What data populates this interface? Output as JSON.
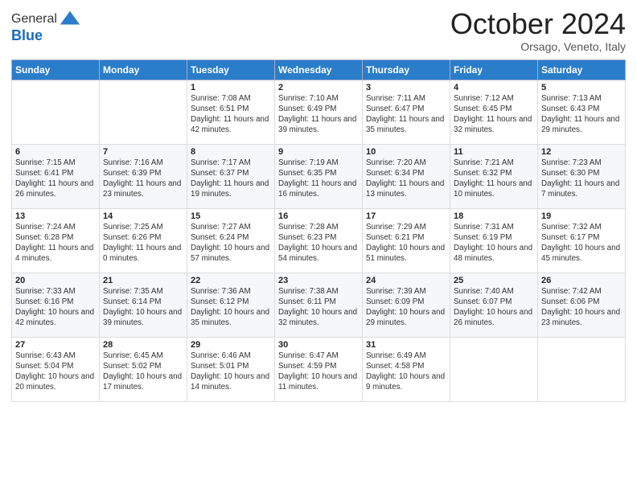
{
  "header": {
    "logo": {
      "line1": "General",
      "line2": "Blue"
    },
    "title": "October 2024",
    "location": "Orsago, Veneto, Italy"
  },
  "calendar": {
    "days_of_week": [
      "Sunday",
      "Monday",
      "Tuesday",
      "Wednesday",
      "Thursday",
      "Friday",
      "Saturday"
    ],
    "weeks": [
      [
        {
          "day": null
        },
        {
          "day": null
        },
        {
          "day": "1",
          "sunrise": "Sunrise: 7:08 AM",
          "sunset": "Sunset: 6:51 PM",
          "daylight": "Daylight: 11 hours and 42 minutes."
        },
        {
          "day": "2",
          "sunrise": "Sunrise: 7:10 AM",
          "sunset": "Sunset: 6:49 PM",
          "daylight": "Daylight: 11 hours and 39 minutes."
        },
        {
          "day": "3",
          "sunrise": "Sunrise: 7:11 AM",
          "sunset": "Sunset: 6:47 PM",
          "daylight": "Daylight: 11 hours and 35 minutes."
        },
        {
          "day": "4",
          "sunrise": "Sunrise: 7:12 AM",
          "sunset": "Sunset: 6:45 PM",
          "daylight": "Daylight: 11 hours and 32 minutes."
        },
        {
          "day": "5",
          "sunrise": "Sunrise: 7:13 AM",
          "sunset": "Sunset: 6:43 PM",
          "daylight": "Daylight: 11 hours and 29 minutes."
        }
      ],
      [
        {
          "day": "6",
          "sunrise": "Sunrise: 7:15 AM",
          "sunset": "Sunset: 6:41 PM",
          "daylight": "Daylight: 11 hours and 26 minutes."
        },
        {
          "day": "7",
          "sunrise": "Sunrise: 7:16 AM",
          "sunset": "Sunset: 6:39 PM",
          "daylight": "Daylight: 11 hours and 23 minutes."
        },
        {
          "day": "8",
          "sunrise": "Sunrise: 7:17 AM",
          "sunset": "Sunset: 6:37 PM",
          "daylight": "Daylight: 11 hours and 19 minutes."
        },
        {
          "day": "9",
          "sunrise": "Sunrise: 7:19 AM",
          "sunset": "Sunset: 6:35 PM",
          "daylight": "Daylight: 11 hours and 16 minutes."
        },
        {
          "day": "10",
          "sunrise": "Sunrise: 7:20 AM",
          "sunset": "Sunset: 6:34 PM",
          "daylight": "Daylight: 11 hours and 13 minutes."
        },
        {
          "day": "11",
          "sunrise": "Sunrise: 7:21 AM",
          "sunset": "Sunset: 6:32 PM",
          "daylight": "Daylight: 11 hours and 10 minutes."
        },
        {
          "day": "12",
          "sunrise": "Sunrise: 7:23 AM",
          "sunset": "Sunset: 6:30 PM",
          "daylight": "Daylight: 11 hours and 7 minutes."
        }
      ],
      [
        {
          "day": "13",
          "sunrise": "Sunrise: 7:24 AM",
          "sunset": "Sunset: 6:28 PM",
          "daylight": "Daylight: 11 hours and 4 minutes."
        },
        {
          "day": "14",
          "sunrise": "Sunrise: 7:25 AM",
          "sunset": "Sunset: 6:26 PM",
          "daylight": "Daylight: 11 hours and 0 minutes."
        },
        {
          "day": "15",
          "sunrise": "Sunrise: 7:27 AM",
          "sunset": "Sunset: 6:24 PM",
          "daylight": "Daylight: 10 hours and 57 minutes."
        },
        {
          "day": "16",
          "sunrise": "Sunrise: 7:28 AM",
          "sunset": "Sunset: 6:23 PM",
          "daylight": "Daylight: 10 hours and 54 minutes."
        },
        {
          "day": "17",
          "sunrise": "Sunrise: 7:29 AM",
          "sunset": "Sunset: 6:21 PM",
          "daylight": "Daylight: 10 hours and 51 minutes."
        },
        {
          "day": "18",
          "sunrise": "Sunrise: 7:31 AM",
          "sunset": "Sunset: 6:19 PM",
          "daylight": "Daylight: 10 hours and 48 minutes."
        },
        {
          "day": "19",
          "sunrise": "Sunrise: 7:32 AM",
          "sunset": "Sunset: 6:17 PM",
          "daylight": "Daylight: 10 hours and 45 minutes."
        }
      ],
      [
        {
          "day": "20",
          "sunrise": "Sunrise: 7:33 AM",
          "sunset": "Sunset: 6:16 PM",
          "daylight": "Daylight: 10 hours and 42 minutes."
        },
        {
          "day": "21",
          "sunrise": "Sunrise: 7:35 AM",
          "sunset": "Sunset: 6:14 PM",
          "daylight": "Daylight: 10 hours and 39 minutes."
        },
        {
          "day": "22",
          "sunrise": "Sunrise: 7:36 AM",
          "sunset": "Sunset: 6:12 PM",
          "daylight": "Daylight: 10 hours and 35 minutes."
        },
        {
          "day": "23",
          "sunrise": "Sunrise: 7:38 AM",
          "sunset": "Sunset: 6:11 PM",
          "daylight": "Daylight: 10 hours and 32 minutes."
        },
        {
          "day": "24",
          "sunrise": "Sunrise: 7:39 AM",
          "sunset": "Sunset: 6:09 PM",
          "daylight": "Daylight: 10 hours and 29 minutes."
        },
        {
          "day": "25",
          "sunrise": "Sunrise: 7:40 AM",
          "sunset": "Sunset: 6:07 PM",
          "daylight": "Daylight: 10 hours and 26 minutes."
        },
        {
          "day": "26",
          "sunrise": "Sunrise: 7:42 AM",
          "sunset": "Sunset: 6:06 PM",
          "daylight": "Daylight: 10 hours and 23 minutes."
        }
      ],
      [
        {
          "day": "27",
          "sunrise": "Sunrise: 6:43 AM",
          "sunset": "Sunset: 5:04 PM",
          "daylight": "Daylight: 10 hours and 20 minutes."
        },
        {
          "day": "28",
          "sunrise": "Sunrise: 6:45 AM",
          "sunset": "Sunset: 5:02 PM",
          "daylight": "Daylight: 10 hours and 17 minutes."
        },
        {
          "day": "29",
          "sunrise": "Sunrise: 6:46 AM",
          "sunset": "Sunset: 5:01 PM",
          "daylight": "Daylight: 10 hours and 14 minutes."
        },
        {
          "day": "30",
          "sunrise": "Sunrise: 6:47 AM",
          "sunset": "Sunset: 4:59 PM",
          "daylight": "Daylight: 10 hours and 11 minutes."
        },
        {
          "day": "31",
          "sunrise": "Sunrise: 6:49 AM",
          "sunset": "Sunset: 4:58 PM",
          "daylight": "Daylight: 10 hours and 9 minutes."
        },
        {
          "day": null
        },
        {
          "day": null
        }
      ]
    ]
  }
}
